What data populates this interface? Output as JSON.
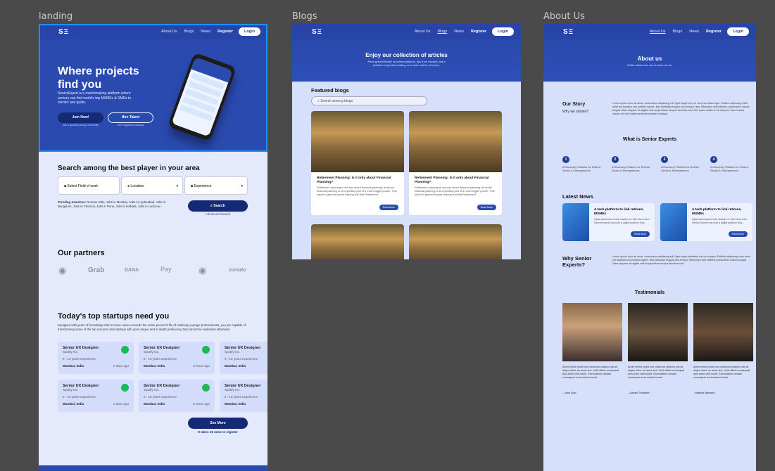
{
  "frames": {
    "landing": "landing",
    "blogs": "Blogs",
    "about": "About Us"
  },
  "nav": {
    "logo": "SΞ",
    "about": "About Us",
    "blogs": "Blogs",
    "news": "News",
    "register": "Register",
    "login": "Login"
  },
  "landing": {
    "hero_title_1": "Where projects",
    "hero_title_2": "find you",
    "hero_desc": "SeniorExpert is a matchmaking platform where seniors can find world's top MSMEs & SMEs to mentor and guide.",
    "join": "Join Now!",
    "join_sub": "Join a growing strong community",
    "hire": "Hire Talent",
    "hire_sub": "100+ registered startups",
    "search_title": "Search among the best player in your area",
    "field": "Select Field of work",
    "location": "Location",
    "experience": "Experience",
    "trending_label": "Trending Searches:",
    "trending": "Remote Jobs, Jobs in Mumbai, Jobs in Hyderabad, Jobs in Bangalore, Jobs in Chennai, Jobs in Pune, Jobs in Kolkata, Jobs in Lucknow",
    "search_btn": "Search",
    "advanced": "Advanced Search",
    "partners_title": "Our partners",
    "partners": [
      "Grab",
      "DANA",
      "Pay",
      "zomato"
    ],
    "startups_title": "Today's top startups need you",
    "startups_desc": "Equipped with years of knowledge that in some cases exceeds the entire period of life of relatively younger professionals, you are capable of transforming some of the top unicorns and startups with your unique and in-depth proficiency that cannot be replicated otherwise.",
    "jobs": [
      {
        "title": "Senior UX Designer",
        "company": "Spotify Inc.",
        "exp": "5 - 10 years experience",
        "loc": "Mumbai, India",
        "time": "6 days ago"
      },
      {
        "title": "Senior UX Designer",
        "company": "Spotify Inc.",
        "exp": "5 - 10 years experience",
        "loc": "Mumbai, India",
        "time": "3 hours ago"
      },
      {
        "title": "Senior UX Designer",
        "company": "Spotify Inc.",
        "exp": "5 - 10 years experience",
        "loc": "Mumbai, India",
        "time": ""
      },
      {
        "title": "Senior UX Designer",
        "company": "Spotify Inc.",
        "exp": "5 - 10 years experience",
        "loc": "Mumbai, India",
        "time": "2 days ago"
      },
      {
        "title": "Senior UX Designer",
        "company": "Spotify Inc.",
        "exp": "5 - 10 years experience",
        "loc": "Mumbai, India",
        "time": "6 hours ago"
      },
      {
        "title": "Senior UX Designer",
        "company": "Spotify Inc.",
        "exp": "2 - 10 years experience",
        "loc": "Mumbai, India",
        "time": ""
      }
    ],
    "see_more": "See More",
    "see_more_sub": "It takes 15 mins to register"
  },
  "blogs": {
    "hero_title": "Enjoy our collection of articles",
    "hero_sub": "Read great lifestyle recommendations, tips from experts and a platform of guests reading on a wide variety of topics.",
    "featured": "Featured blogs",
    "search_placeholder": "Search among blogs",
    "post_title": "Retirement Planning: Is it only about Financial Planning?",
    "post_desc": "Retirement planning is not only about financial planning, its broad financial planning is an important part of a much bigger puzzle. This article is geared toward helping find that Retirement.",
    "read": "Read More"
  },
  "about": {
    "hero_title": "About us",
    "hero_sub": "A little about who we do what we do.",
    "story_title": "Our Story",
    "story_sub": "Why we started?",
    "story_text": "Lorem ipsum dolor sit amet, consectetur adipiscing elit. Eget fusgit et in per nunc sed diam aget. Porttitor adipiscing vitae amet est faucibus sed porttitor sapien. Mar habitasse feugiat urna tempor ullat. Bibendum velit eleifend consectetur mauris feugiat. Diam aliquam et sagittis velit suspendisse tempus faucibus erat. Sed quam mattis in est aliquam. Nam massa mauris vel velit mattis hendrerit praesent volutpat.",
    "what_title": "What is Senior Experts",
    "steps": [
      {
        "n": "1",
        "t": "A Discovery Platform for Retired Senior & Entrepreneurs"
      },
      {
        "n": "2",
        "t": "A Discovery Platform for Retired Senior & Entrepreneurs"
      },
      {
        "n": "3",
        "t": "A Discovery Platform for Retired Senior & Entrepreneurs"
      },
      {
        "n": "4",
        "t": "A Discovery Platform for Retired Senior & Entrepreneurs"
      }
    ],
    "news_title": "Latest News",
    "news_item": "A tech platform to link retirees, MSMEs",
    "news_desc": "Hyderabad-based tech startup on 10th November SeniorExperts has built a digital platform that...",
    "news_btn": "Read More",
    "why_title_1": "Why Senior",
    "why_title_2": "Experts?",
    "why_text": "Lorem ipsum dolor sit amet, consectetur adipiscing elit. Eget turpis habitasse nisi vel semper. Porttitor adipiscing vitae amet est faucibus sed porttitor sapien. Mar habitasse feugiat urna tempor. Bibendum velit eleifend consectetur mauris feugiat. Diam aliquam et sagittis velit suspendisse tempus faucibus erat.",
    "testimonials_title": "Testimonials",
    "testimonials": [
      {
        "text": "Amet minim mollit non deserunt ullamco est sit aliqua dolor do amet sint. Velit officia consequat duis enim velit mollit. Exercitation veniam consequat sunt nostrud amet.",
        "name": "- Jane Doe"
      },
      {
        "text": "Amet minim mollit non deserunt ullamco est sit aliqua dolor do amet sint. Velit officia consequat duis enim velit mollit. Exercitation veniam consequat sunt nostrud amet.",
        "name": "- Daniel Thrasher"
      },
      {
        "text": "Amet minim mollit non deserunt ullamco est sit aliqua dolor do amet sint. Velit officia consequat duis enim velit mollit. Exercitation veniam consequat sunt nostrud amet.",
        "name": "- Martha Wendell"
      }
    ]
  },
  "colors": {
    "brand": "#2a4ab0",
    "selection": "#1e90ff",
    "pale": "#dde4fb",
    "button": "#1f3b99"
  }
}
